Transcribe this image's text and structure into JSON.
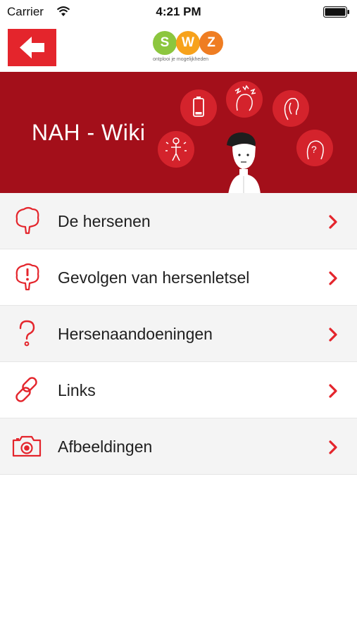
{
  "status_bar": {
    "carrier": "Carrier",
    "time": "4:21 PM"
  },
  "header": {
    "back_icon": "arrow-left-icon",
    "logo_letters": [
      "S",
      "W",
      "Z"
    ],
    "logo_tagline": "ontplooi je mogelijkheden"
  },
  "banner": {
    "title": "NAH - Wiki"
  },
  "menu": {
    "items": [
      {
        "label": "De hersenen",
        "icon": "brain-icon"
      },
      {
        "label": "Gevolgen van hersenletsel",
        "icon": "brain-alert-icon"
      },
      {
        "label": "Hersenaandoeningen",
        "icon": "question-mark-icon"
      },
      {
        "label": "Links",
        "icon": "link-icon"
      },
      {
        "label": "Afbeeldingen",
        "icon": "camera-icon"
      }
    ]
  },
  "colors": {
    "accent": "#e4252c",
    "banner": "#a30f1a",
    "logo_s": "#8cc63e",
    "logo_w": "#f7a21b",
    "logo_z": "#ef7d22"
  }
}
